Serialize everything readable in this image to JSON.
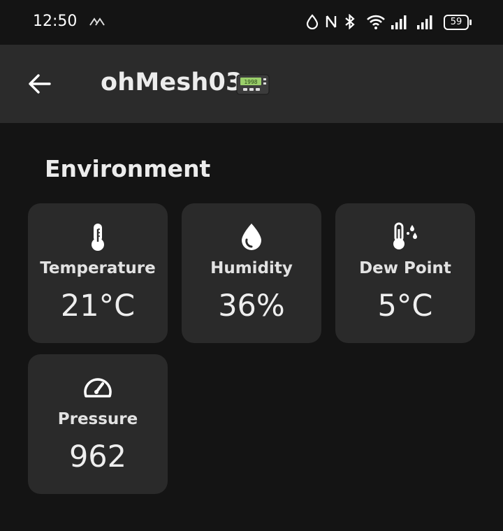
{
  "status_bar": {
    "time": "12:50",
    "battery": "59",
    "icons": [
      "carrier-logo-icon",
      "data-saver-icon",
      "nfc-icon",
      "bluetooth-icon",
      "wifi-icon",
      "signal-1-icon",
      "signal-2-icon",
      "battery-icon"
    ]
  },
  "app_bar": {
    "title": "ohMesh03",
    "back_icon": "arrow-left-icon",
    "title_icon": "pager-icon"
  },
  "section": {
    "title": "Environment"
  },
  "cards": [
    {
      "label": "Temperature",
      "value": "21°C",
      "icon": "thermometer-icon"
    },
    {
      "label": "Humidity",
      "value": "36%",
      "icon": "water-drop-icon"
    },
    {
      "label": "Dew Point",
      "value": "5°C",
      "icon": "dew-point-icon"
    },
    {
      "label": "Pressure",
      "value": "962",
      "icon": "speedometer-icon"
    }
  ]
}
